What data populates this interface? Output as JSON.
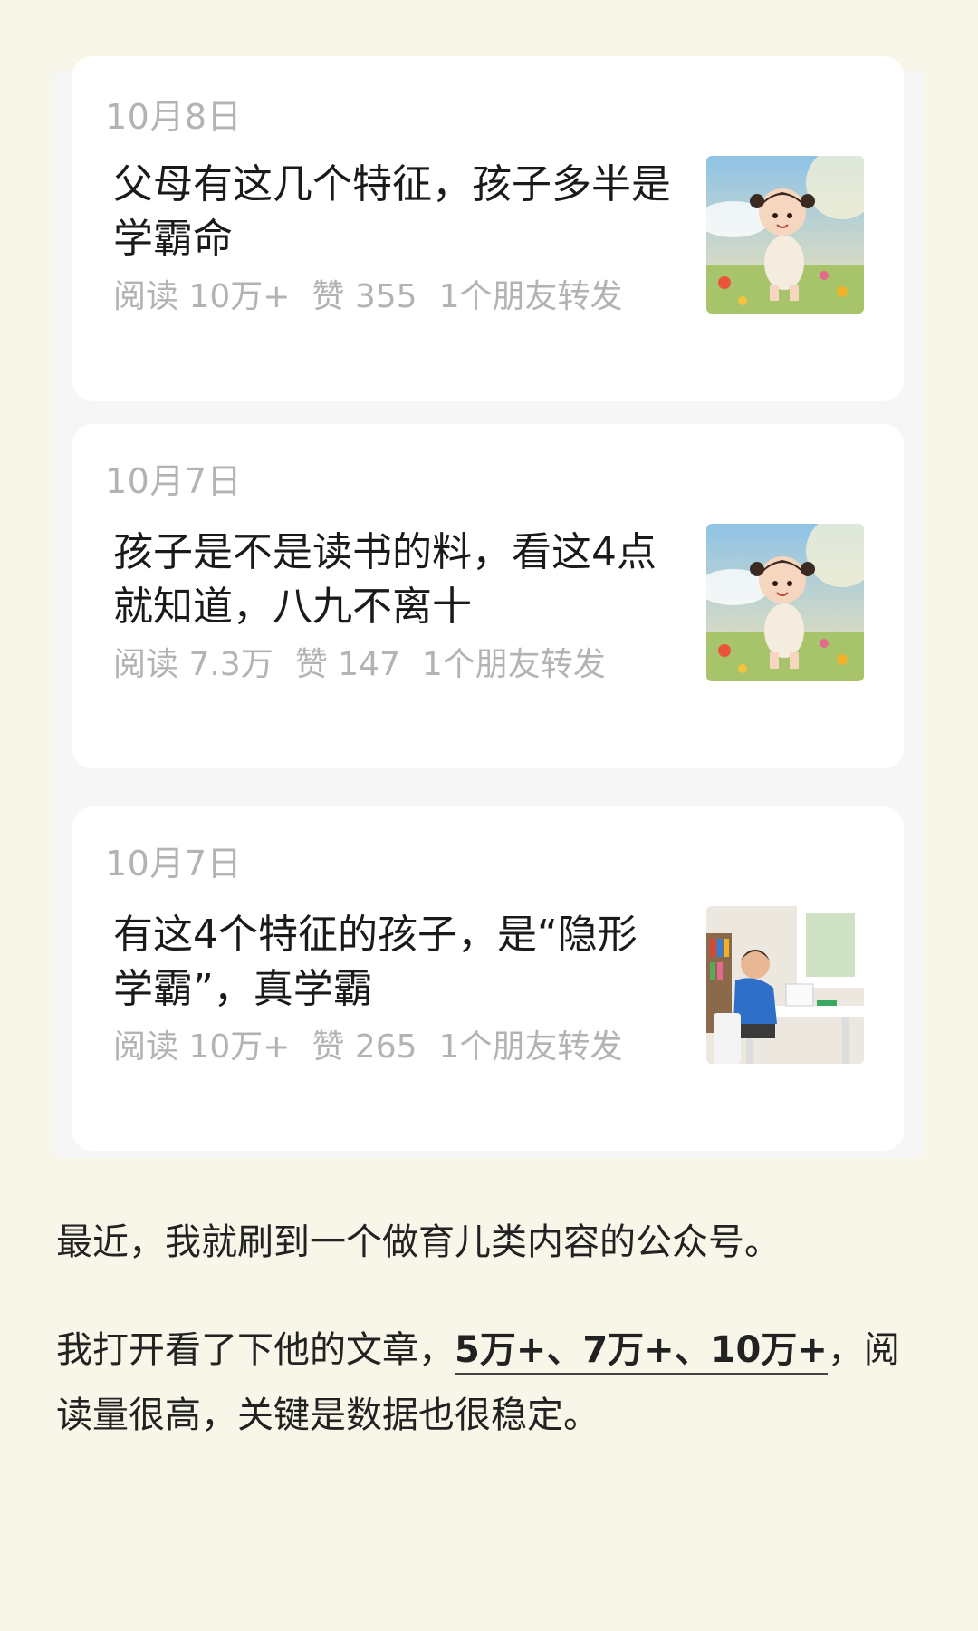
{
  "articles": [
    {
      "date": "10月8日",
      "title": "父母有这几个特征，孩子多半是学霸命",
      "reads": "阅读 10万+",
      "likes": "赞 355",
      "shares": "1个朋友转发",
      "thumbnail": "girl-in-flower-field-image"
    },
    {
      "date": "10月7日",
      "title": "孩子是不是读书的料，看这4点就知道，八九不离十",
      "reads": "阅读 7.3万",
      "likes": "赞 147",
      "shares": "1个朋友转发",
      "thumbnail": "girl-in-flower-field-image"
    },
    {
      "date": "10月7日",
      "title": "有这4个特征的孩子，是“隐形学霸”，真学霸",
      "reads": "阅读 10万+",
      "likes": "赞 265",
      "shares": "1个朋友转发",
      "thumbnail": "boy-studying-at-desk-image"
    }
  ],
  "body": {
    "p1": "最近，我就刷到一个做育儿类内容的公众号。",
    "p2_before": "我打开看了下他的文章，",
    "p2_highlight": "5万+、7万+、10万+",
    "p2_after": "，阅读量很高，关键是数据也很稳定。"
  },
  "colors": {
    "page_bg": "#f8f6e8",
    "card_bg": "#ffffff",
    "meta_gray": "#b3b3b3",
    "title_text": "#1a1a1a"
  }
}
